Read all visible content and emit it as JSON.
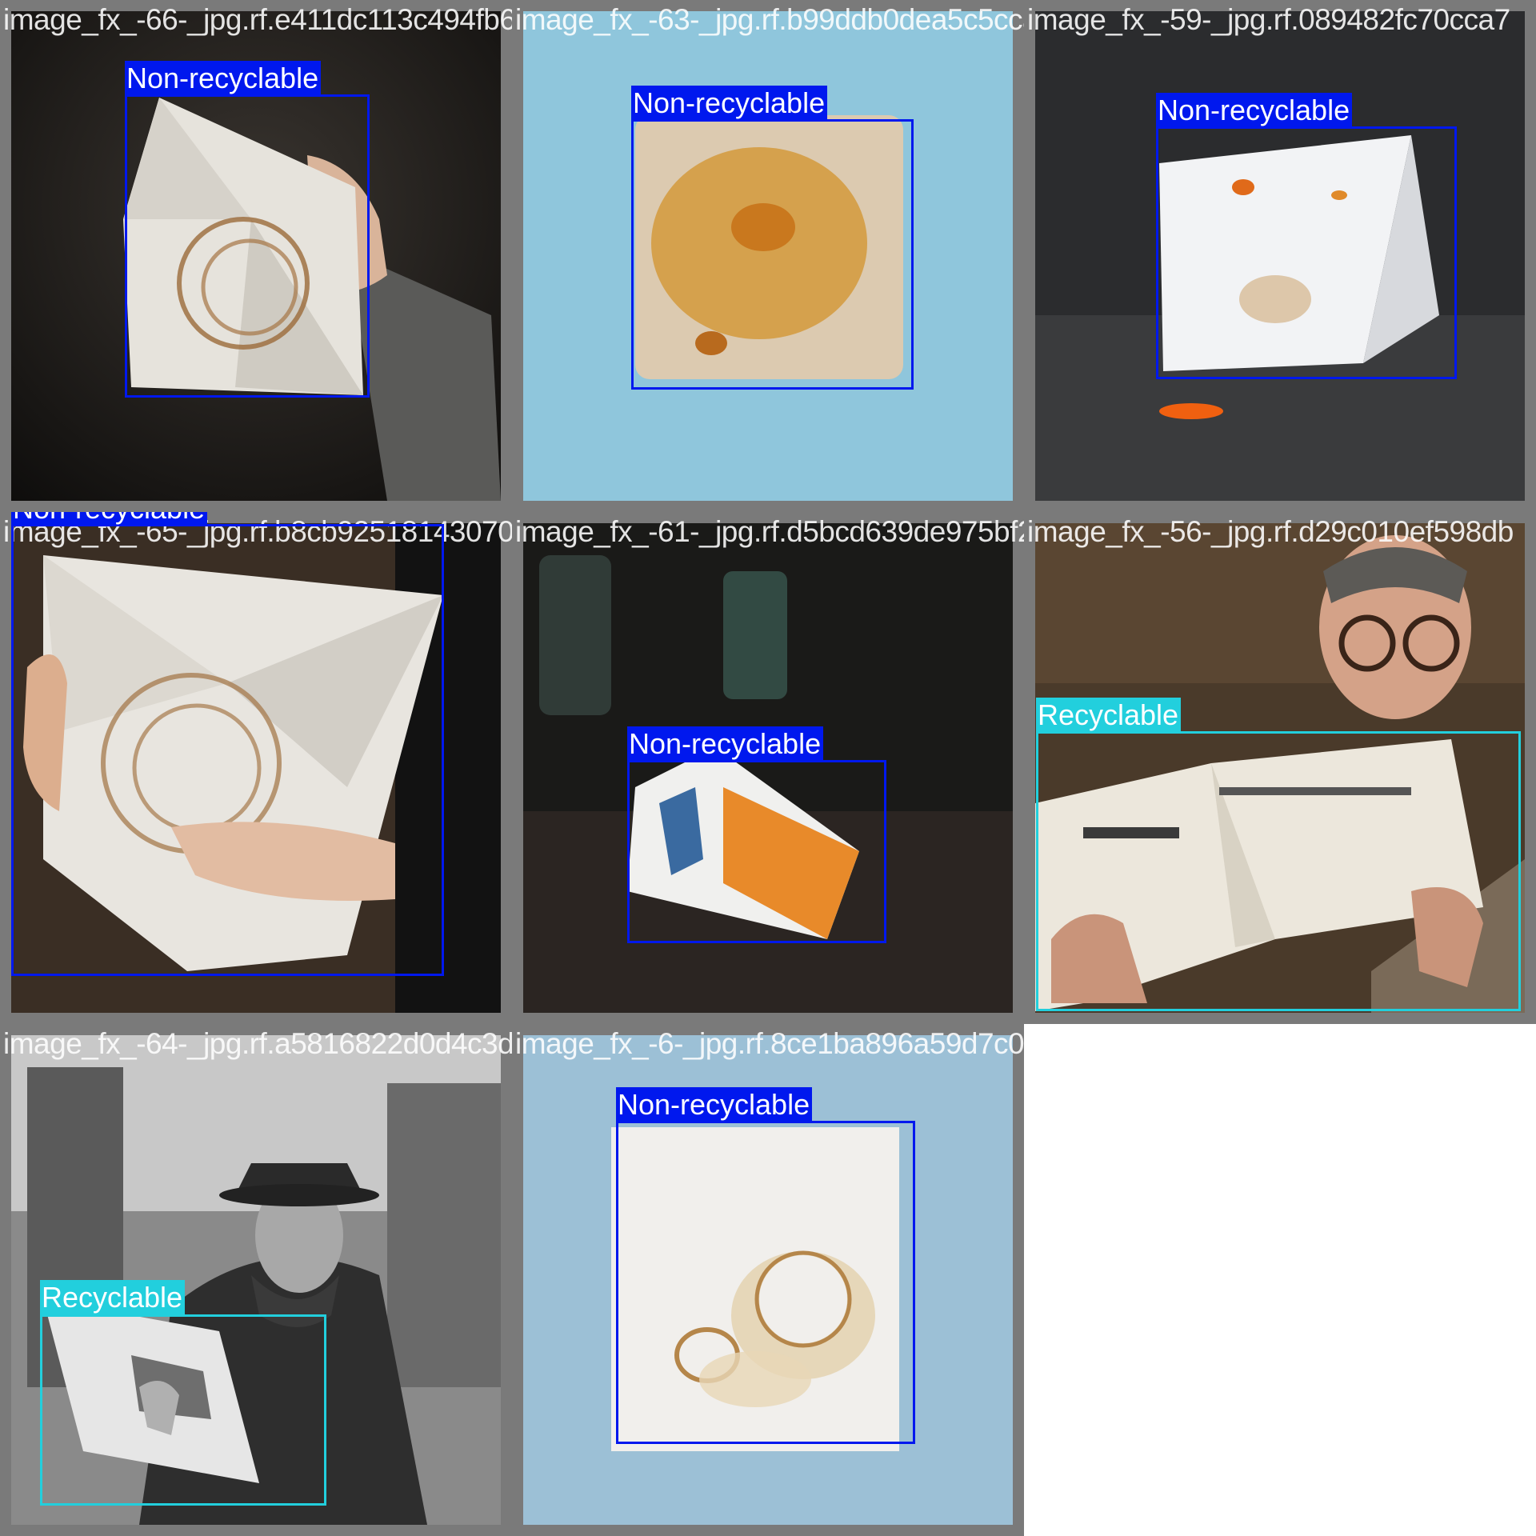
{
  "colors": {
    "non_recyclable": "#0018ee",
    "recyclable": "#22cfdd",
    "tile_border": "#7a7a7a"
  },
  "tiles": [
    {
      "filename": "image_fx_-66-_jpg.rf.e411dc113c494fb6ada",
      "detections": [
        {
          "label": "Non-recyclable",
          "class": "nr"
        }
      ]
    },
    {
      "filename": "image_fx_-63-_jpg.rf.b99ddb0dea5c5ccadb0",
      "detections": [
        {
          "label": "Non-recyclable",
          "class": "nr"
        }
      ]
    },
    {
      "filename": "image_fx_-59-_jpg.rf.089482fc70cca7",
      "detections": [
        {
          "label": "Non-recyclable",
          "class": "nr"
        }
      ]
    },
    {
      "filename": "image_fx_-65-_jpg.rf.b8cb92518143070f8e8",
      "detections": [
        {
          "label": "Non-recyclable",
          "class": "nr"
        }
      ]
    },
    {
      "filename": "image_fx_-61-_jpg.rf.d5bcd639de975bf24cda",
      "detections": [
        {
          "label": "Non-recyclable",
          "class": "nr"
        }
      ]
    },
    {
      "filename": "image_fx_-56-_jpg.rf.d29c010ef598db",
      "detections": [
        {
          "label": "Recyclable",
          "class": "r"
        }
      ]
    },
    {
      "filename": "image_fx_-64-_jpg.rf.a5816822d0d4c3d8e64",
      "detections": [
        {
          "label": "Recyclable",
          "class": "r"
        }
      ]
    },
    {
      "filename": "image_fx_-6-_jpg.rf.8ce1ba896a59d7c0159c",
      "detections": [
        {
          "label": "Non-recyclable",
          "class": "nr"
        }
      ]
    }
  ]
}
